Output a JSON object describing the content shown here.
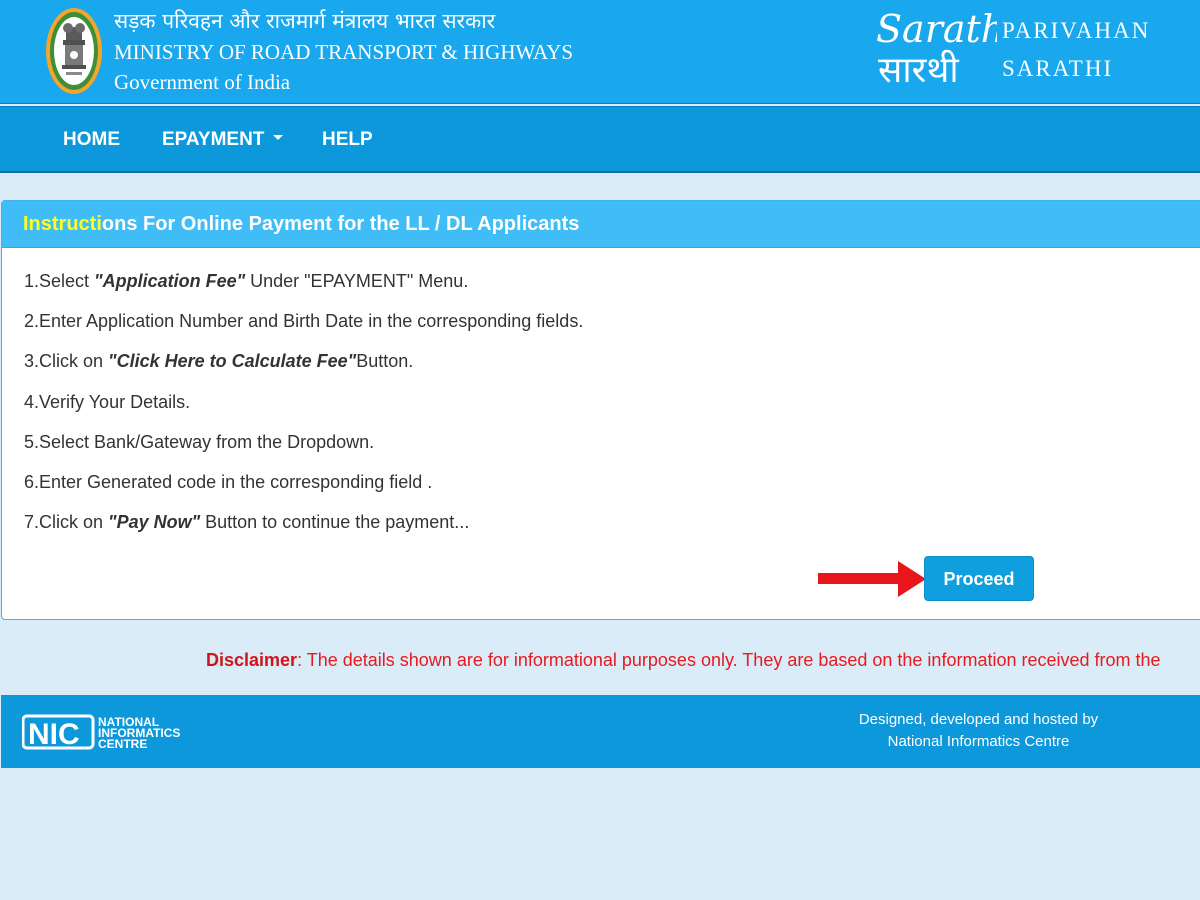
{
  "header": {
    "ministry_hindi": "सड़क परिवहन और राजमार्ग मंत्रालय भारत सरकार",
    "ministry_english": "MINISTRY OF ROAD TRANSPORT & HIGHWAYS",
    "government": "Government of India",
    "logo_script_top": "Sarathi",
    "logo_script_bottom": "सारथी",
    "brand_line1": "PARIVAHAN",
    "brand_line2": "SARATHI",
    "emblem_icon": "state-emblem-icon"
  },
  "nav": {
    "home": "HOME",
    "epayment": "EPAYMENT",
    "help": "HELP"
  },
  "panel": {
    "title_highlight": "Instructi",
    "title_rest": "ons For Online Payment for the LL / DL Applicants",
    "steps": [
      {
        "pre": "1.Select ",
        "bold": "\"Application Fee\"",
        "post": " Under \"EPAYMENT\" Menu."
      },
      {
        "pre": "2.Enter Application Number and Birth Date in the corresponding fields.",
        "bold": "",
        "post": ""
      },
      {
        "pre": "3.Click on ",
        "bold": "\"Click Here to Calculate Fee\"",
        "post": "Button."
      },
      {
        "pre": "4.Verify Your Details.",
        "bold": "",
        "post": ""
      },
      {
        "pre": "5.Select Bank/Gateway from the Dropdown.",
        "bold": "",
        "post": ""
      },
      {
        "pre": "6.Enter Generated code in the corresponding field .",
        "bold": "",
        "post": ""
      },
      {
        "pre": "7.Click on ",
        "bold": "\"Pay Now\"",
        "post": " Button to continue the payment..."
      }
    ],
    "proceed_label": "Proceed"
  },
  "disclaimer": {
    "label": "Disclaimer",
    "text": ": The details shown are for informational purposes only. They are based on the information received from the"
  },
  "footer": {
    "nic_line1": "NATIONAL",
    "nic_line2": "INFORMATICS",
    "nic_line3": "CENTRE",
    "nic_mark": "NIC",
    "credit_line1": "Designed, developed and hosted by",
    "credit_line2": "National Informatics Centre"
  },
  "colors": {
    "header_bg": "#19a7ed",
    "nav_bg": "#0c98da",
    "panel_heading_bg": "#40bdf7",
    "highlight": "#ffff1e",
    "button_bg": "#109fde",
    "disclaimer": "#e8191f",
    "arrow": "#e8151b",
    "page_bg": "#d9ecf7"
  }
}
